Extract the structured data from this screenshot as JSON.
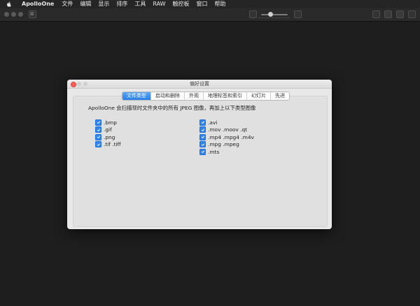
{
  "menubar": {
    "app_name": "ApolloOne",
    "items": [
      "文件",
      "编辑",
      "显示",
      "排序",
      "工具",
      "RAW",
      "触控板",
      "窗口",
      "帮助"
    ]
  },
  "dialog": {
    "title": "偏好设置",
    "tabs": [
      {
        "label": "文件类型",
        "active": true
      },
      {
        "label": "启动和删除",
        "active": false
      },
      {
        "label": "外观",
        "active": false
      },
      {
        "label": "地理标签和索引",
        "active": false
      },
      {
        "label": "幻灯片",
        "active": false
      },
      {
        "label": "先进",
        "active": false
      }
    ],
    "description": "ApolloOne 会扫描现时文件夹中的所有 JPEG 图像，再加上以下类型图像",
    "image_types": [
      {
        "label": ".bmp",
        "checked": true
      },
      {
        "label": ".gif",
        "checked": true
      },
      {
        "label": ".png",
        "checked": true
      },
      {
        "label": ".tif .tiff",
        "checked": true
      }
    ],
    "video_types": [
      {
        "label": ".avi",
        "checked": true
      },
      {
        "label": ".mov .moov .qt",
        "checked": true
      },
      {
        "label": ".mp4 .mpg4 .m4v",
        "checked": true
      },
      {
        "label": ".mpg .mpeg",
        "checked": true
      },
      {
        "label": ".mts",
        "checked": true
      }
    ]
  },
  "colors": {
    "accent": "#2f86f0",
    "close_button": "#fc605b"
  },
  "icons": [
    "apple-icon",
    "grid-icon",
    "checkmark-icon"
  ]
}
